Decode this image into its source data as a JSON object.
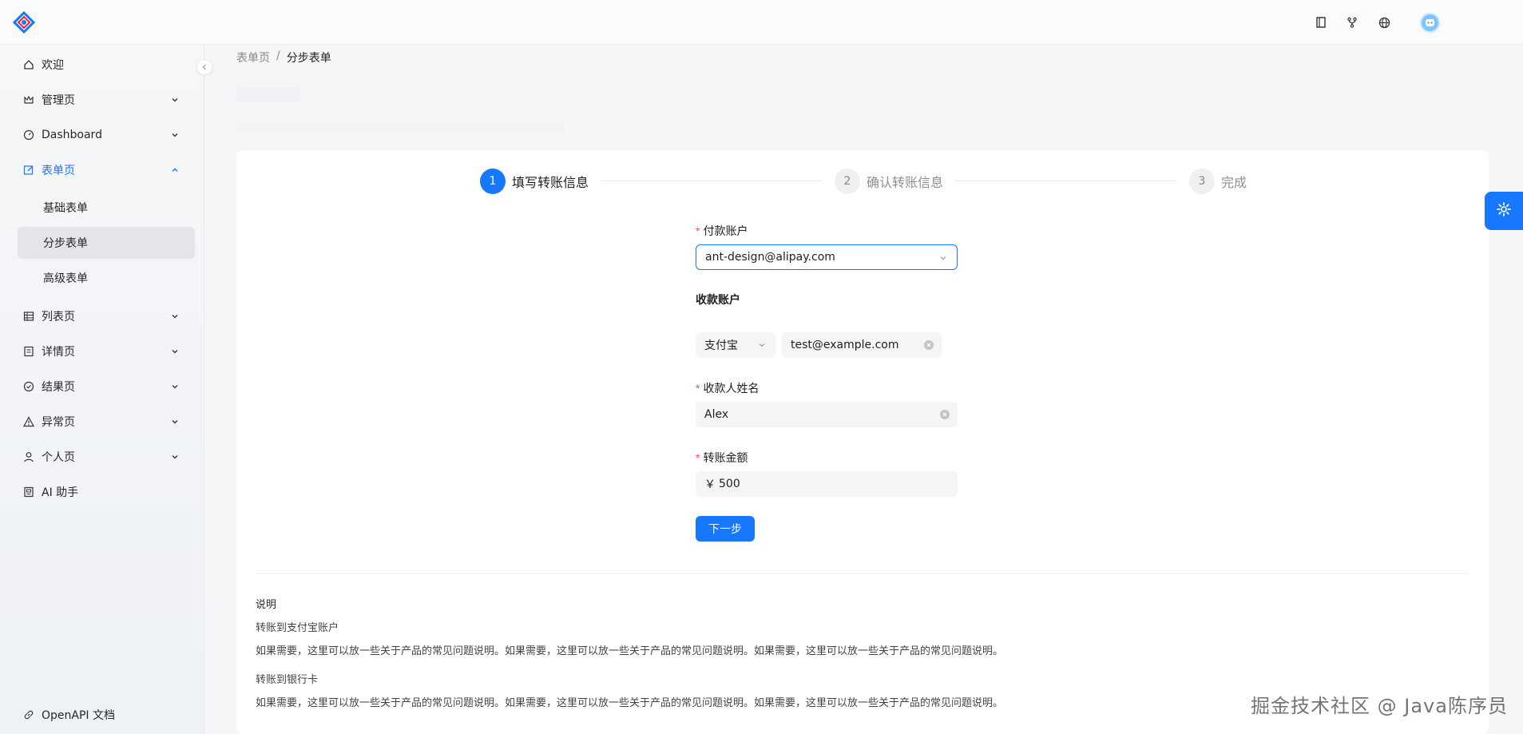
{
  "header": {
    "icons": [
      "book-icon",
      "fork-icon",
      "globe-icon",
      "avatar"
    ]
  },
  "sidebar": {
    "items": [
      {
        "label": "欢迎",
        "icon": "home-icon"
      },
      {
        "label": "管理页",
        "icon": "crown-icon"
      },
      {
        "label": "Dashboard",
        "icon": "dashboard-icon"
      },
      {
        "label": "表单页",
        "icon": "form-icon"
      },
      {
        "label": "列表页",
        "icon": "table-icon"
      },
      {
        "label": "详情页",
        "icon": "profile-icon"
      },
      {
        "label": "结果页",
        "icon": "check-circle-icon"
      },
      {
        "label": "异常页",
        "icon": "warning-icon"
      },
      {
        "label": "个人页",
        "icon": "user-icon"
      },
      {
        "label": "AI 助手",
        "icon": "robot-icon"
      }
    ],
    "form_submenu": [
      "基础表单",
      "分步表单",
      "高级表单"
    ],
    "footer_link": "OpenAPI 文档"
  },
  "breadcrumb": {
    "parent": "表单页",
    "separator": "/",
    "current": "分步表单"
  },
  "steps": [
    {
      "num": "1",
      "title": "填写转账信息",
      "status": "process"
    },
    {
      "num": "2",
      "title": "确认转账信息",
      "status": "wait"
    },
    {
      "num": "3",
      "title": "完成",
      "status": "wait"
    }
  ],
  "form": {
    "pay_account_label": "付款账户",
    "pay_account_value": "ant-design@alipay.com",
    "receive_account_label": "收款账户",
    "receive_type": "支付宝",
    "receive_account_value": "test@example.com",
    "receiver_name_label": "收款人姓名",
    "receiver_name_value": "Alex",
    "amount_label": "转账金额",
    "amount_prefix": "￥",
    "amount_value": "500",
    "next_button": "下一步"
  },
  "description": {
    "title": "说明",
    "section1_title": "转账到支付宝账户",
    "section1_text": "如果需要，这里可以放一些关于产品的常见问题说明。如果需要，这里可以放一些关于产品的常见问题说明。如果需要，这里可以放一些关于产品的常见问题说明。",
    "section2_title": "转账到银行卡",
    "section2_text": "如果需要，这里可以放一些关于产品的常见问题说明。如果需要，这里可以放一些关于产品的常见问题说明。如果需要，这里可以放一些关于产品的常见问题说明。"
  },
  "watermark": "掘金技术社区 @ Java陈序员",
  "colors": {
    "primary": "#1677ff",
    "required": "#ff4d4f"
  }
}
